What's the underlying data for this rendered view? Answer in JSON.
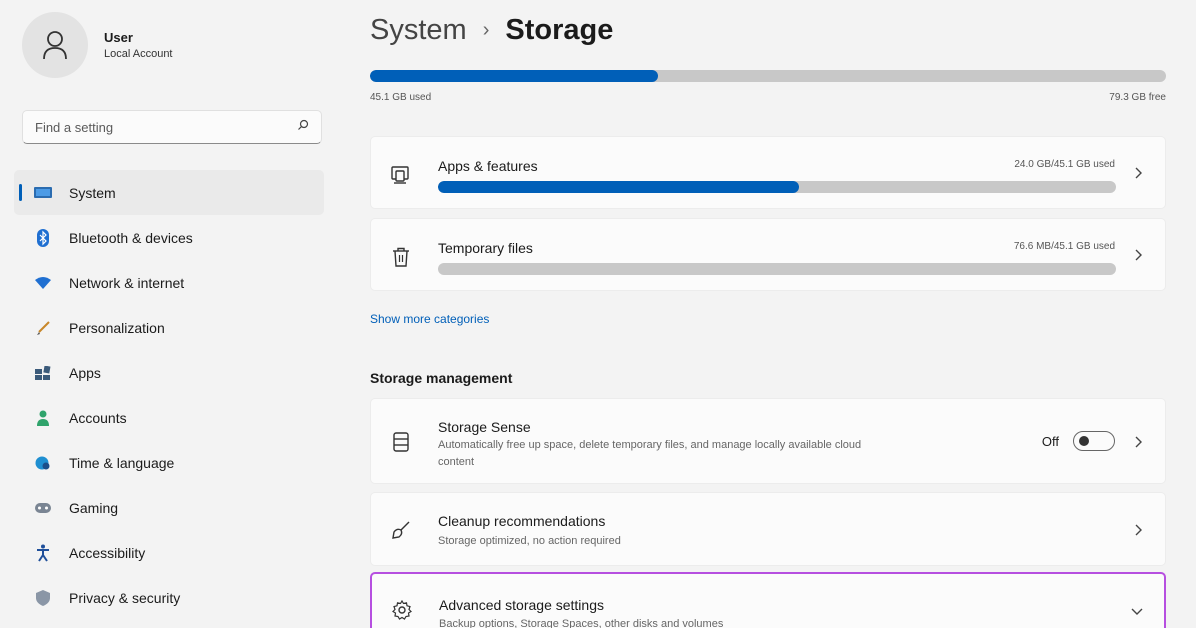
{
  "user": {
    "name": "User",
    "account_type": "Local Account",
    "avatar_icon": "person-icon"
  },
  "search": {
    "placeholder": "Find a setting",
    "icon": "search-icon"
  },
  "nav": {
    "items": [
      {
        "label": "System",
        "icon": "system-icon",
        "selected": true
      },
      {
        "label": "Bluetooth & devices",
        "icon": "bluetooth-icon"
      },
      {
        "label": "Network & internet",
        "icon": "wifi-icon"
      },
      {
        "label": "Personalization",
        "icon": "brush-icon"
      },
      {
        "label": "Apps",
        "icon": "apps-icon"
      },
      {
        "label": "Accounts",
        "icon": "accounts-icon"
      },
      {
        "label": "Time & language",
        "icon": "globe-clock-icon"
      },
      {
        "label": "Gaming",
        "icon": "gamepad-icon"
      },
      {
        "label": "Accessibility",
        "icon": "accessibility-icon"
      },
      {
        "label": "Privacy & security",
        "icon": "shield-icon"
      }
    ]
  },
  "breadcrumb": {
    "parent": "System",
    "separator": "›",
    "current": "Storage"
  },
  "storage": {
    "used_label": "45.1 GB used",
    "free_label": "79.3 GB free",
    "used_fraction": 0.362
  },
  "categories": [
    {
      "title": "Apps & features",
      "usage": "24.0 GB/45.1 GB used",
      "fraction": 0.532,
      "icon": "apps-features-icon"
    },
    {
      "title": "Temporary files",
      "usage": "76.6 MB/45.1 GB used",
      "fraction": 0.0,
      "icon": "trash-icon"
    }
  ],
  "show_more": "Show more categories",
  "management": {
    "title": "Storage management",
    "storage_sense": {
      "title": "Storage Sense",
      "desc": "Automatically free up space, delete temporary files, and manage locally available cloud content",
      "toggle_label": "Off",
      "icon": "storage-drive-icon"
    },
    "cleanup": {
      "title": "Cleanup recommendations",
      "desc": "Storage optimized, no action required",
      "icon": "broom-icon"
    },
    "advanced": {
      "title": "Advanced storage settings",
      "desc": "Backup options, Storage Spaces, other disks and volumes",
      "icon": "gear-icon"
    }
  },
  "colors": {
    "accent": "#005fb8",
    "highlight": "#b64fe0",
    "bar_track": "#c8c8c8"
  }
}
